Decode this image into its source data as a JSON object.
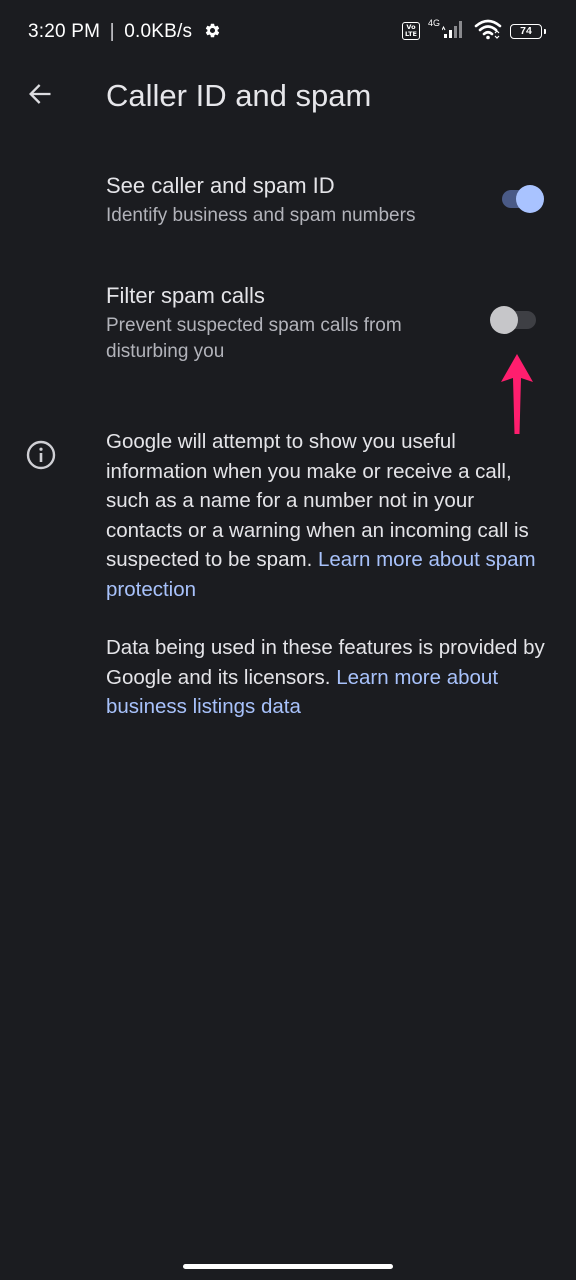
{
  "status_bar": {
    "time": "3:20 PM",
    "separator": "|",
    "net_speed": "0.0KB/s",
    "volte_label": "Vo\nLTE",
    "network_type": "4G",
    "battery": "74",
    "icons": [
      "gear-icon",
      "volte-icon",
      "signal-icon",
      "wifi-icon",
      "battery-icon"
    ]
  },
  "app_bar": {
    "title": "Caller ID and spam",
    "back_icon": "arrow-left-icon"
  },
  "settings": [
    {
      "title": "See caller and spam ID",
      "subtitle": "Identify business and spam numbers",
      "enabled": true
    },
    {
      "title": "Filter spam calls",
      "subtitle": "Prevent suspected spam calls from disturbing you",
      "enabled": false
    }
  ],
  "info": {
    "icon": "info-icon",
    "paragraph1_text": "Google will attempt to show you useful information when you make or receive a call, such as a name for a number not in your contacts or a warning when an incoming call is suspected to be spam. ",
    "paragraph1_link": "Learn more about spam protection",
    "paragraph2_text": "Data being used in these features is provided by Google and its licensors. ",
    "paragraph2_link": "Learn more about business listings data"
  },
  "colors": {
    "background": "#1b1c20",
    "accent": "#a8c2fb",
    "toggle_on_track": "#4a5a86",
    "toggle_on_thumb": "#a9c3ff",
    "toggle_off_track": "#3e3f44",
    "toggle_off_thumb": "#c6c6c9",
    "annotation": "#ff1e6e"
  }
}
